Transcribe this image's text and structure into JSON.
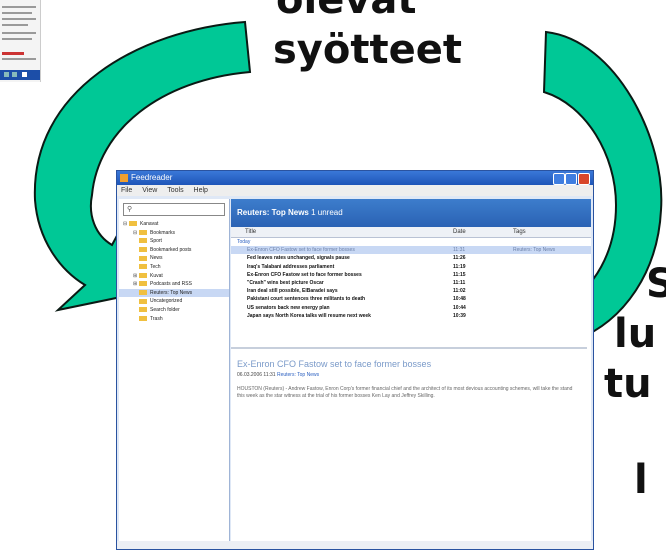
{
  "heading_top": {
    "line1": "olevat",
    "line2": "syötteet"
  },
  "right_fragments": [
    "S",
    "lu",
    "tu",
    "l"
  ],
  "app": {
    "title": "Feedreader",
    "menu": [
      "File",
      "View",
      "Tools",
      "Help"
    ],
    "search_placeholder": "",
    "sidebar": {
      "root": "Kanavat",
      "items": [
        {
          "label": "Bookmarks",
          "expand": "⊟"
        },
        {
          "label": "Sport",
          "expand": ""
        },
        {
          "label": "Bookmarked posts",
          "expand": ""
        },
        {
          "label": "News",
          "expand": ""
        },
        {
          "label": "Tech",
          "expand": ""
        },
        {
          "label": "Kuvat",
          "expand": "⊞"
        },
        {
          "label": "Podcasts and RSS",
          "expand": "⊞"
        },
        {
          "label": "Reuters: Top News",
          "expand": ""
        },
        {
          "label": "Uncategorized",
          "expand": ""
        },
        {
          "label": "Search folder",
          "expand": ""
        },
        {
          "label": "Trash",
          "expand": ""
        }
      ]
    },
    "feed": {
      "title": "Reuters: Top News",
      "unread": "1 unread",
      "columns": [
        "Title",
        "Date",
        "Tags"
      ],
      "group_label": "Today",
      "rows": [
        {
          "title": "Ex-Enron CFO Fastow set to face former bosses",
          "date": "11:31",
          "tags": "Reuters: Top News"
        },
        {
          "title": "Fed leaves rates unchanged, signals pause",
          "date": "11:26",
          "tags": ""
        },
        {
          "title": "Iraq's Talabani addresses parliament",
          "date": "11:19",
          "tags": ""
        },
        {
          "title": "Ex-Enron CFO Fastow set to face former bosses",
          "date": "11:15",
          "tags": ""
        },
        {
          "title": "\"Crash\" wins best picture Oscar",
          "date": "11:11",
          "tags": ""
        },
        {
          "title": "Iran deal still possible, ElBaradei says",
          "date": "11:02",
          "tags": ""
        },
        {
          "title": "Pakistani court sentences three militants to death",
          "date": "10:48",
          "tags": ""
        },
        {
          "title": "US senators back new energy plan",
          "date": "10:44",
          "tags": ""
        },
        {
          "title": "Japan says North Korea talks will resume next week",
          "date": "10:39",
          "tags": ""
        }
      ]
    },
    "reader": {
      "article_title": "Ex-Enron CFO Fastow set to face former bosses",
      "meta_date": "06.03.2006 11:31",
      "meta_links": "Reuters: Top News",
      "body": "HOUSTON (Reuters) - Andrew Fastow, Enron Corp's former financial chief and the architect of its most devious accounting schemes, will take the stand this week as the star witness at the trial of his former bosses Ken Lay and Jeffrey Skilling."
    }
  },
  "colors": {
    "arrow_fill": "#00c896",
    "arrow_stroke": "#0a1a14",
    "accent": "#2a62b4"
  }
}
